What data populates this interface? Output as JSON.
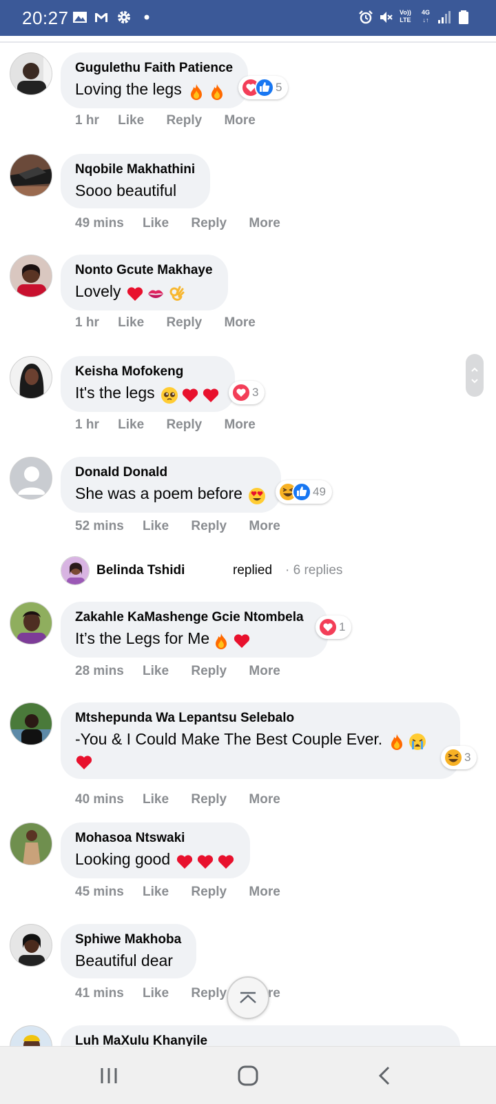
{
  "status_bar": {
    "time": "20:27",
    "network_top": "Vo))",
    "network_bottom": "LTE",
    "signal_label": "4G",
    "icons": [
      "gallery-icon",
      "gmail-icon",
      "settings-icon",
      "dot-icon",
      "alarm-icon",
      "mute-icon",
      "volte-icon",
      "signal-icon",
      "battery-icon"
    ]
  },
  "actions": {
    "like": "Like",
    "reply": "Reply",
    "more": "More"
  },
  "colors": {
    "status_bar": "#3b5998",
    "bubble": "#f0f2f5",
    "meta_text": "#8a8d91",
    "heart": "#f33e58",
    "like": "#1877f2"
  },
  "comments": [
    {
      "name": "Gugulethu Faith Patience",
      "text": "Loving the legs",
      "emojis": [
        "fire",
        "fire"
      ],
      "time": "1 hr",
      "reactions": [
        "love",
        "like"
      ],
      "reaction_count": "5"
    },
    {
      "name": "Nqobile Makhathini",
      "text": "Sooo beautiful",
      "emojis": [],
      "time": "49 mins"
    },
    {
      "name": "Nonto Gcute Makhaye",
      "text": "Lovely",
      "emojis": [
        "heart",
        "kiss",
        "ok-hand"
      ],
      "time": "1 hr"
    },
    {
      "name": "Keisha Mofokeng",
      "text": "It's the legs",
      "emojis": [
        "pleading",
        "heart",
        "heart"
      ],
      "time": "1 hr",
      "reactions": [
        "love"
      ],
      "reaction_count": "3"
    },
    {
      "name": "Donald Donald",
      "text": "She was a poem before",
      "emojis": [
        "heart-eyes"
      ],
      "time": "52 mins",
      "reactions": [
        "haha",
        "like"
      ],
      "reaction_count": "49"
    },
    {
      "name": "Zakahle KaMashenge Gcie Ntombela",
      "text": "It’s the Legs for Me",
      "emojis": [
        "fire",
        "heart"
      ],
      "time": "28 mins",
      "reactions": [
        "love"
      ],
      "reaction_count": "1"
    },
    {
      "name": "Mtshepunda Wa Lepantsu Selebalo",
      "text": "-You & I Could Make The Best Couple Ever.",
      "emojis": [
        "fire",
        "crying",
        "heart"
      ],
      "time": "40 mins",
      "reactions": [
        "haha"
      ],
      "reaction_count": "3"
    },
    {
      "name": "Mohasoa Ntswaki",
      "text": "Looking good",
      "emojis": [
        "heart",
        "heart",
        "heart"
      ],
      "time": "45 mins"
    },
    {
      "name": "Sphiwe Makhoba",
      "text": "Beautiful dear",
      "emojis": [],
      "time": "41 mins"
    },
    {
      "name": "Luh MaXulu Khanyile"
    }
  ],
  "reply_preview": {
    "name": "Belinda Tshidi",
    "verb": "replied",
    "count": "· 6 replies"
  }
}
